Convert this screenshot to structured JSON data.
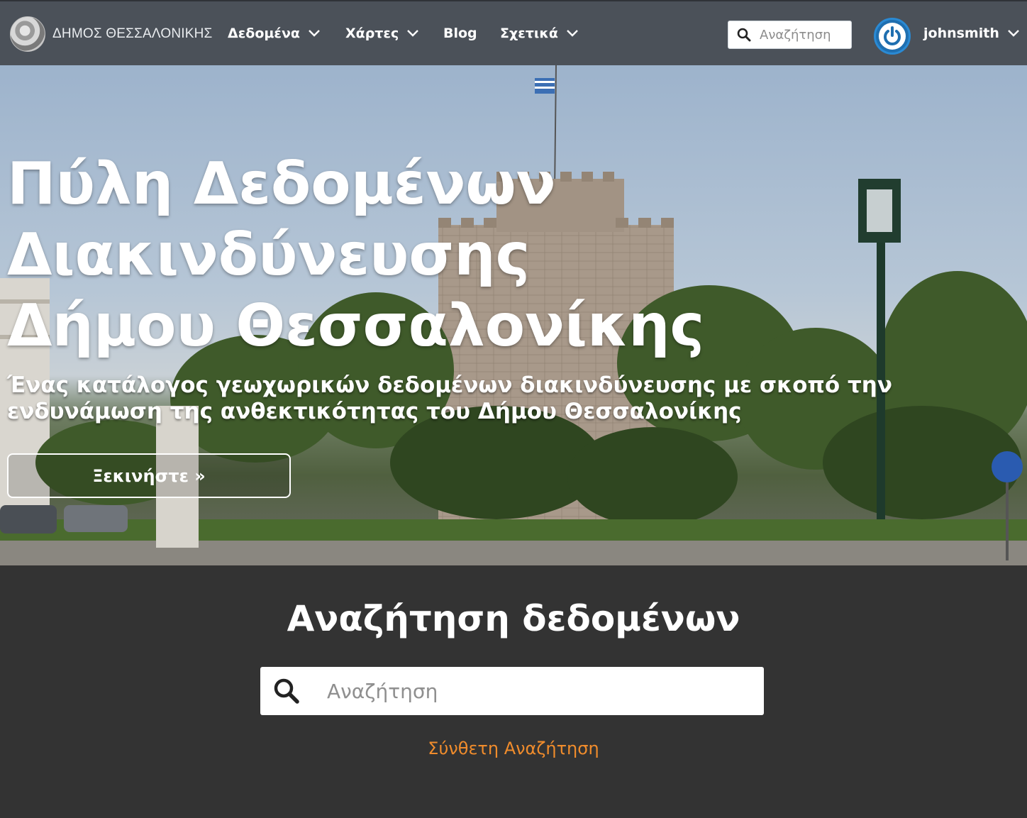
{
  "navbar": {
    "logo_text": "ΔΗΜΟΣ ΘΕΣΣΑΛΟΝΙΚΗΣ",
    "items": [
      {
        "label": "Δεδομένα",
        "has_dropdown": true
      },
      {
        "label": "Χάρτες",
        "has_dropdown": true
      },
      {
        "label": "Blog",
        "has_dropdown": false
      },
      {
        "label": "Σχετικά",
        "has_dropdown": true
      }
    ],
    "search_placeholder": "Αναζήτηση",
    "user_name": "johnsmith",
    "colors": {
      "background": "#4b5159",
      "text": "#ffffff"
    }
  },
  "hero": {
    "title_lines": [
      "Πύλη Δεδομένων",
      "Διακινδύνευσης",
      "Δήμου Θεσσαλονίκης"
    ],
    "subtitle_lines": [
      "Ένας κατάλογος γεωχωρικών δεδομένων διακινδύνευσης με σκοπό την",
      "ενδυνάμωση της ανθεκτικότητας του Δήμου Θεσσαλονίκης"
    ],
    "cta_label": "Ξεκινήστε »"
  },
  "search_section": {
    "heading": "Αναζήτηση δεδομένων",
    "placeholder": "Αναζήτηση",
    "advanced_link": "Σύνθετη Αναζήτηση",
    "colors": {
      "background": "#333333",
      "link": "#f08c2c"
    }
  },
  "icons": [
    "logo-emblem-icon",
    "chevron-down-icon",
    "search-icon",
    "user-power-icon"
  ]
}
